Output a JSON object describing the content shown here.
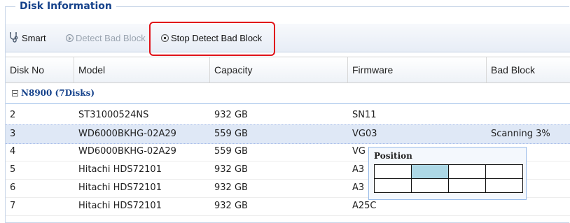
{
  "panel": {
    "title": "Disk Information"
  },
  "toolbar": {
    "smart_label": "Smart",
    "detect_label": "Detect Bad Block",
    "stop_label": "Stop Detect Bad Block"
  },
  "grid": {
    "columns": [
      "Disk No",
      "Model",
      "Capacity",
      "Firmware",
      "Bad Block"
    ],
    "group_label": "N8900 (7Disks)",
    "rows": [
      {
        "disk_no": "2",
        "model": "ST31000524NS",
        "capacity": "932 GB",
        "firmware": "SN11",
        "bad_block": ""
      },
      {
        "disk_no": "3",
        "model": "WD6000BKHG-02A29",
        "capacity": "559 GB",
        "firmware": "VG03",
        "bad_block": "Scanning 3%"
      },
      {
        "disk_no": "4",
        "model": "WD6000BKHG-02A29",
        "capacity": "559 GB",
        "firmware": "VG",
        "bad_block": ""
      },
      {
        "disk_no": "5",
        "model": "Hitachi HDS72101",
        "capacity": "932 GB",
        "firmware": "A3",
        "bad_block": ""
      },
      {
        "disk_no": "6",
        "model": "Hitachi HDS72101",
        "capacity": "932 GB",
        "firmware": "A3",
        "bad_block": ""
      },
      {
        "disk_no": "7",
        "model": "Hitachi HDS72101",
        "capacity": "932 GB",
        "firmware": "A25C",
        "bad_block": ""
      }
    ],
    "selected_row": 1
  },
  "position_popup": {
    "title": "Position",
    "rows": 2,
    "cols": 4,
    "highlighted": [
      [
        0,
        1
      ]
    ]
  },
  "colors": {
    "legend": "#15428b",
    "selected_row": "#dfe8f6",
    "highlight_box": "#e0131a",
    "position_active": "#add8e6"
  }
}
